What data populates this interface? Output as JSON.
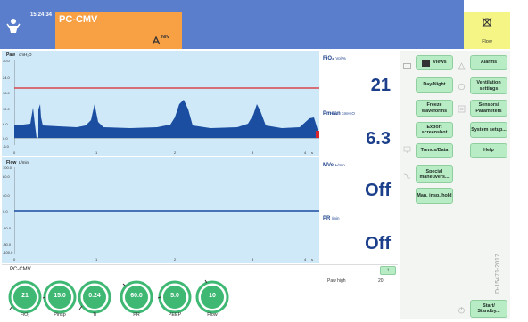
{
  "header": {
    "time": "15:24:34",
    "mode": "PC-CMV",
    "niv_label": "NIV",
    "alarm_label": "Flow"
  },
  "paw_panel": {
    "label": "Paw",
    "unit": "cmH₂O",
    "y_ticks": [
      "30.0",
      "24.0",
      "18.0",
      "12.0",
      "6.0",
      "0.0",
      "-6.0"
    ],
    "x_ticks": [
      "0",
      "1",
      "2",
      "3",
      "4"
    ],
    "x_unit": "s"
  },
  "flow_panel": {
    "label": "Flow",
    "unit": "L/min",
    "y_ticks": [
      "100.0",
      "80.0",
      "40.0",
      "0.0",
      "-40.0",
      "-80.0",
      "-100.0"
    ],
    "x_ticks": [
      "0",
      "1",
      "2",
      "3",
      "4"
    ],
    "x_unit": "s"
  },
  "values": [
    {
      "name": "FiO₂",
      "unit": "Vol.%",
      "value": "21"
    },
    {
      "name": "Pmean",
      "unit": "cmH₂O",
      "value": "6.3"
    },
    {
      "name": "MVe",
      "unit": "L/min",
      "value": "Off"
    },
    {
      "name": "PR",
      "unit": "/min",
      "value": "Off"
    }
  ],
  "menu_buttons": {
    "views": "Views",
    "day_night": "Day/Night",
    "freeze": "Freeze\nwaveforms",
    "export": "Export\nscreenshot",
    "trends": "Trends/Data",
    "special": "Special\nmaneuvers...",
    "man_insp": "Man. insp./hold",
    "alarms": "Alarms",
    "ventilation": "Ventilation\nsettings",
    "sensors": "Sensors/\nParameters",
    "system_setup": "System setup...",
    "help": "Help",
    "standby": "Start/\nStandby..."
  },
  "status_bar": {
    "mode": "PC-CMV",
    "arrow": "↑"
  },
  "bottom": {
    "message": "Paw high",
    "message_value": "20"
  },
  "settings": [
    {
      "label": "FiO₂",
      "value": "21"
    },
    {
      "label": "Pinsp",
      "value": "15.0"
    },
    {
      "label": "Ti",
      "value": "0.24"
    },
    {
      "label": "PR",
      "value": "60.0"
    },
    {
      "label": "PEEP",
      "value": "5.0"
    },
    {
      "label": "Flow",
      "value": "10"
    }
  ],
  "side_text": "D-15471-2017",
  "colors": {
    "header_blue": "#5a7ecb",
    "mode_orange": "#f7a044",
    "alarm_yellow": "#f5f586",
    "wave_fill": "#1b4ea1",
    "alarm_line": "#d9252c",
    "knob_green": "#3fb874",
    "button_green": "#b8ecc4"
  }
}
